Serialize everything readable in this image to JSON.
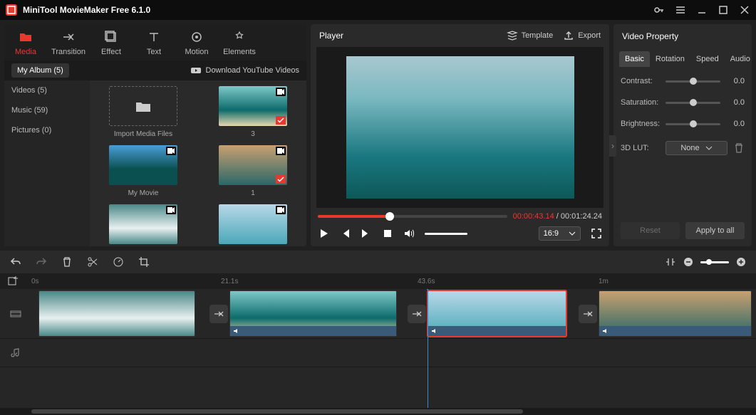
{
  "app": {
    "title": "MiniTool MovieMaker Free 6.1.0"
  },
  "tooltabs": [
    {
      "label": "Media",
      "active": true
    },
    {
      "label": "Transition"
    },
    {
      "label": "Effect"
    },
    {
      "label": "Text"
    },
    {
      "label": "Motion"
    },
    {
      "label": "Elements"
    }
  ],
  "media_sub": {
    "album": "My Album (5)",
    "download": "Download YouTube Videos"
  },
  "media_cats": [
    {
      "label": "Videos (5)"
    },
    {
      "label": "Music (59)"
    },
    {
      "label": "Pictures (0)"
    }
  ],
  "media_items": {
    "import": "Import Media Files",
    "c2": "3",
    "c3": "My Movie",
    "c4": "1"
  },
  "player": {
    "label": "Player",
    "template": "Template",
    "export": "Export",
    "current": "00:00:43.14",
    "total": "00:01:24.24",
    "aspect": "16:9"
  },
  "prop": {
    "title": "Video Property",
    "tabs": {
      "basic": "Basic",
      "rotation": "Rotation",
      "speed": "Speed",
      "audio": "Audio"
    },
    "contrast": {
      "label": "Contrast:",
      "value": "0.0"
    },
    "saturation": {
      "label": "Saturation:",
      "value": "0.0"
    },
    "brightness": {
      "label": "Brightness:",
      "value": "0.0"
    },
    "lut": {
      "label": "3D LUT:",
      "value": "None"
    },
    "reset": "Reset",
    "apply": "Apply to all"
  },
  "ruler": {
    "t0": "0s",
    "t1": "21.1s",
    "t2": "43.6s",
    "t3": "1m"
  }
}
